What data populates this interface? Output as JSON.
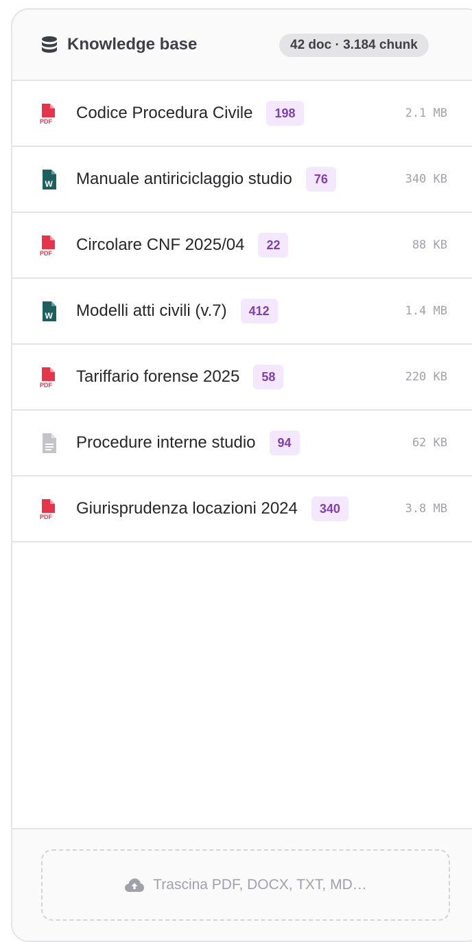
{
  "header": {
    "title": "Knowledge base",
    "icon": "database-icon",
    "stats": "42 doc · 3.184 chunk"
  },
  "documents": [
    {
      "name": "Codice Procedura Civile",
      "chunks": "198",
      "size": "2.1 MB",
      "type": "pdf",
      "icon": "pdf-file-icon"
    },
    {
      "name": "Manuale antiriciclaggio studio",
      "chunks": "76",
      "size": "340 KB",
      "type": "word",
      "icon": "word-file-icon"
    },
    {
      "name": "Circolare CNF 2025/04",
      "chunks": "22",
      "size": "88 KB",
      "type": "pdf",
      "icon": "pdf-file-icon"
    },
    {
      "name": "Modelli atti civili (v.7)",
      "chunks": "412",
      "size": "1.4 MB",
      "type": "word",
      "icon": "word-file-icon"
    },
    {
      "name": "Tariffario forense 2025",
      "chunks": "58",
      "size": "220 KB",
      "type": "pdf",
      "icon": "pdf-file-icon"
    },
    {
      "name": "Procedure interne studio",
      "chunks": "94",
      "size": "62 KB",
      "type": "text",
      "icon": "text-file-icon"
    },
    {
      "name": "Giurisprudenza locazioni 2024",
      "chunks": "340",
      "size": "3.8 MB",
      "type": "pdf",
      "icon": "pdf-file-icon"
    }
  ],
  "dropzone": {
    "label": "Trascina PDF, DOCX, TXT, MD…",
    "icon": "cloud-upload-icon"
  },
  "colors": {
    "pdf": "#e5354a",
    "word": "#1e5e5e",
    "text": "#c4c4c8",
    "badge_bg": "#f3e8ff",
    "badge_text": "#7e3faf"
  }
}
